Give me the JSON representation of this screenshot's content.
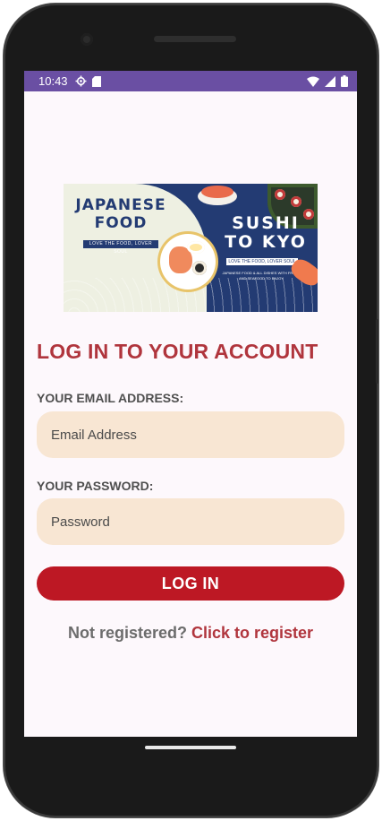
{
  "status_bar": {
    "time": "10:43",
    "icons": [
      "settings-gear-icon",
      "sd-card-icon",
      "wifi-icon",
      "signal-icon",
      "battery-icon"
    ],
    "color": "#6a4fa3"
  },
  "banner": {
    "left_title": "JAPANESE FOOD",
    "left_tagline": "LOVE THE FOOD, LOVER SOUL",
    "right_title": "SUSHI TO KYO",
    "right_tagline": "LOVE THE FOOD, LOVER SOUL",
    "right_desc": "JAPANESE FOOD & ALL DISHES WITH FRESH AND SEAFOOD TO ENJOY"
  },
  "login": {
    "heading": "LOG IN TO YOUR ACCOUNT",
    "email_label": "YOUR EMAIL ADDRESS:",
    "email_placeholder": "Email Address",
    "email_value": "",
    "password_label": "YOUR PASSWORD:",
    "password_placeholder": "Password",
    "password_value": "",
    "submit_label": "LOG IN",
    "register_prompt": "Not registered?",
    "register_link": "Click to register"
  },
  "colors": {
    "accent": "#b0353d",
    "button": "#bd1824",
    "field_bg": "#f8e6d3",
    "screen_bg": "#fdf8fc"
  }
}
